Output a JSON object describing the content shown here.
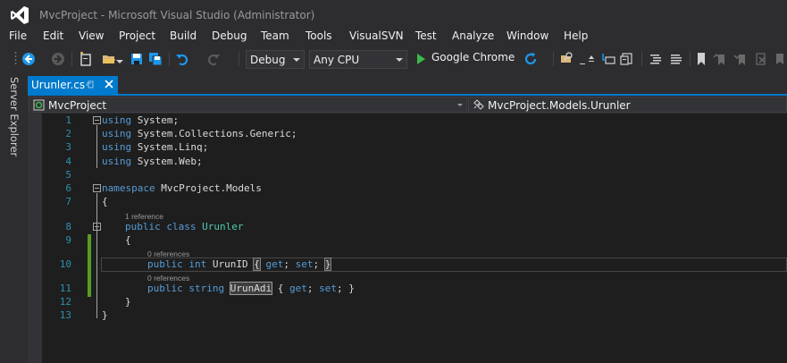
{
  "window": {
    "title": "MvcProject - Microsoft Visual Studio (Administrator)"
  },
  "menu": [
    "File",
    "Edit",
    "View",
    "Project",
    "Build",
    "Debug",
    "Team",
    "Tools",
    "VisualSVN",
    "Test",
    "Analyze",
    "Window",
    "Help"
  ],
  "toolbar": {
    "configuration": "Debug",
    "platform": "Any CPU",
    "run_target": "Google Chrome",
    "icons": [
      "back-icon",
      "forward-icon",
      "new-project-icon",
      "open-file-icon",
      "save-icon",
      "save-all-icon",
      "undo-icon",
      "redo-icon",
      "start-icon",
      "refresh-icon",
      "find-icon",
      "bookmark-icon"
    ]
  },
  "side_panel": {
    "label": "Server Explorer"
  },
  "document_tab": {
    "label": "Urunler.cs"
  },
  "navigation": {
    "project": "MvcProject",
    "type": "MvcProject.Models.Urunler"
  },
  "editor": {
    "line_numbers": [
      "1",
      "2",
      "3",
      "4",
      "5",
      "6",
      "7",
      "8",
      "9",
      "10",
      "11",
      "12",
      "13"
    ],
    "lines": {
      "l1": {
        "kw": "using",
        "rest": " System;"
      },
      "l2": {
        "kw": "using",
        "rest": " System.Collections.Generic;"
      },
      "l3": {
        "kw": "using",
        "rest": " System.Linq;"
      },
      "l4": {
        "kw": "using",
        "rest": " System.Web;"
      },
      "l6": {
        "kw": "namespace",
        "rest": " MvcProject.Models"
      },
      "l7": "{",
      "l8": {
        "kw1": "public",
        "kw2": "class",
        "type": "Urunler"
      },
      "l9": "{",
      "l10": {
        "kw1": "public",
        "kw2": "int",
        "name": "UrunID",
        "open": "{",
        "get": "get",
        "set": "set",
        "close": "}"
      },
      "l11": {
        "kw1": "public",
        "kw2": "string",
        "name": "UrunAdi",
        "open": "{",
        "get": "get",
        "set": "set",
        "close": "}"
      },
      "l12": "}",
      "l13": "}"
    },
    "codelens": {
      "class_refs": "1 reference",
      "prop1_refs": "0 references",
      "prop2_refs": "0 references"
    }
  },
  "colors": {
    "accent": "#007acc",
    "keyword": "#569cd6",
    "type": "#4ec9b0",
    "line_number": "#2b91af",
    "change_marker": "#579d25"
  }
}
